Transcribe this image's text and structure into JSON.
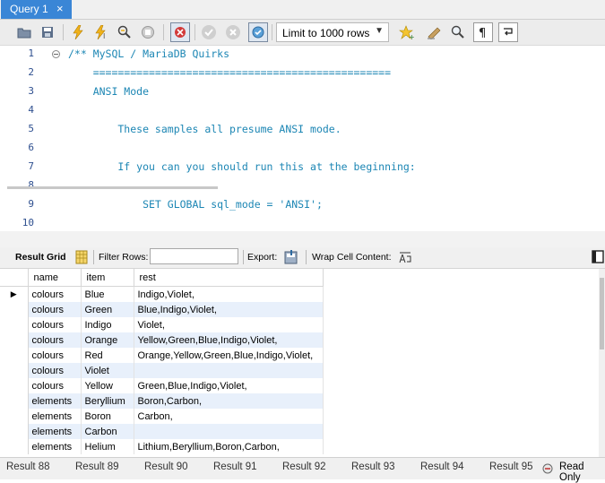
{
  "tab": {
    "title": "Query 1",
    "close": "×"
  },
  "toolbar": {
    "limit_label": "Limit to 1000 rows",
    "icons": [
      "open-folder-icon",
      "save-icon",
      "execute-icon",
      "execute-current-icon",
      "explain-icon",
      "stop-icon",
      "toggle-error-icon",
      "commit-icon",
      "rollback-icon",
      "autocommit-icon",
      "favorites-icon",
      "beautify-icon",
      "find-icon",
      "invisible-chars-icon",
      "wrap-icon"
    ]
  },
  "editor": {
    "lines": [
      {
        "n": "1",
        "text": "/** MySQL / MariaDB Quirks"
      },
      {
        "n": "2",
        "text": "    ================================================"
      },
      {
        "n": "3",
        "text": "    ANSI Mode"
      },
      {
        "n": "4",
        "text": ""
      },
      {
        "n": "5",
        "text": "        These samples all presume ANSI mode."
      },
      {
        "n": "6",
        "text": ""
      },
      {
        "n": "7",
        "text": "        If you can you should run this at the beginning:"
      },
      {
        "n": "8",
        "text": ""
      },
      {
        "n": "9",
        "text": "            SET GLOBAL sql_mode = 'ANSI';"
      },
      {
        "n": "10",
        "text": ""
      }
    ]
  },
  "result_toolbar": {
    "result_grid": "Result Grid",
    "filter_rows": "Filter Rows:",
    "export": "Export:",
    "wrap": "Wrap Cell Content:"
  },
  "grid": {
    "columns": [
      "name",
      "item",
      "rest"
    ],
    "rows": [
      [
        "colours",
        "Blue",
        "Indigo,Violet,"
      ],
      [
        "colours",
        "Green",
        "Blue,Indigo,Violet,"
      ],
      [
        "colours",
        "Indigo",
        "Violet,"
      ],
      [
        "colours",
        "Orange",
        "Yellow,Green,Blue,Indigo,Violet,"
      ],
      [
        "colours",
        "Red",
        "Orange,Yellow,Green,Blue,Indigo,Violet,"
      ],
      [
        "colours",
        "Violet",
        ""
      ],
      [
        "colours",
        "Yellow",
        "Green,Blue,Indigo,Violet,"
      ],
      [
        "elements",
        "Beryllium",
        "Boron,Carbon,"
      ],
      [
        "elements",
        "Boron",
        "Carbon,"
      ],
      [
        "elements",
        "Carbon",
        ""
      ],
      [
        "elements",
        "Helium",
        "Lithium,Beryllium,Boron,Carbon,"
      ]
    ]
  },
  "bottom_tabs": [
    "Result 88",
    "Result 89",
    "Result 90",
    "Result 91",
    "Result 92",
    "Result 93",
    "Result 94",
    "Result 95"
  ],
  "status": {
    "read_only": "Read Only"
  },
  "colors": {
    "tab_active": "#3a86d6",
    "code": "#1c86b4",
    "row_alt": "#e8f0fb"
  }
}
